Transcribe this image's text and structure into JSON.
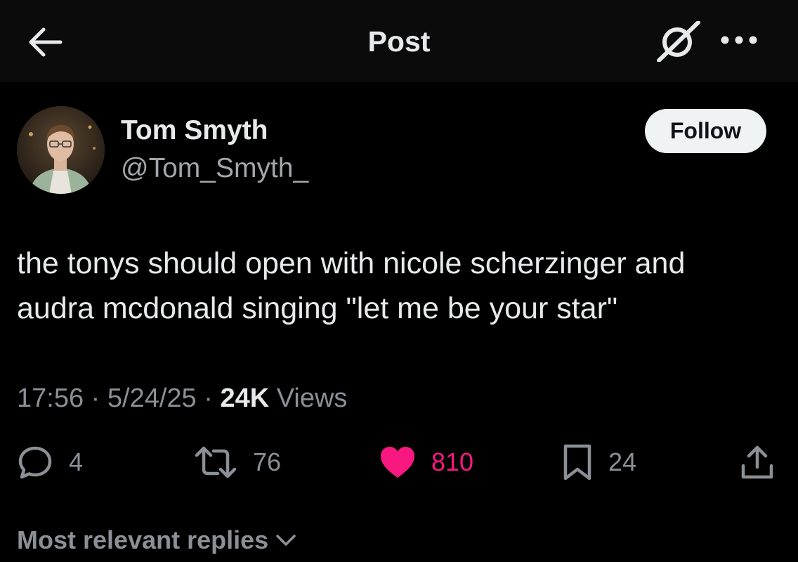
{
  "header": {
    "title": "Post",
    "back_icon": "arrow-left-icon",
    "grok_icon": "grok-icon",
    "more_icon": "more-dots-icon"
  },
  "author": {
    "name": "Tom Smyth",
    "handle": "@Tom_Smyth_",
    "follow_label": "Follow"
  },
  "tweet": {
    "text": "the tonys should open with nicole scherzinger and\naudra mcdonald singing \"let me be your star\""
  },
  "meta": {
    "time": "17:56",
    "separator": "·",
    "date": "5/24/25",
    "views_count": "24K",
    "views_label": "Views"
  },
  "actions": {
    "replies": "4",
    "reposts": "76",
    "likes": "810",
    "bookmarks": "24"
  },
  "replies_sort": {
    "label": "Most relevant replies"
  },
  "colors": {
    "background": "#000000",
    "like": "#f91880",
    "muted": "#8b9096",
    "text": "#e7e9ea"
  }
}
